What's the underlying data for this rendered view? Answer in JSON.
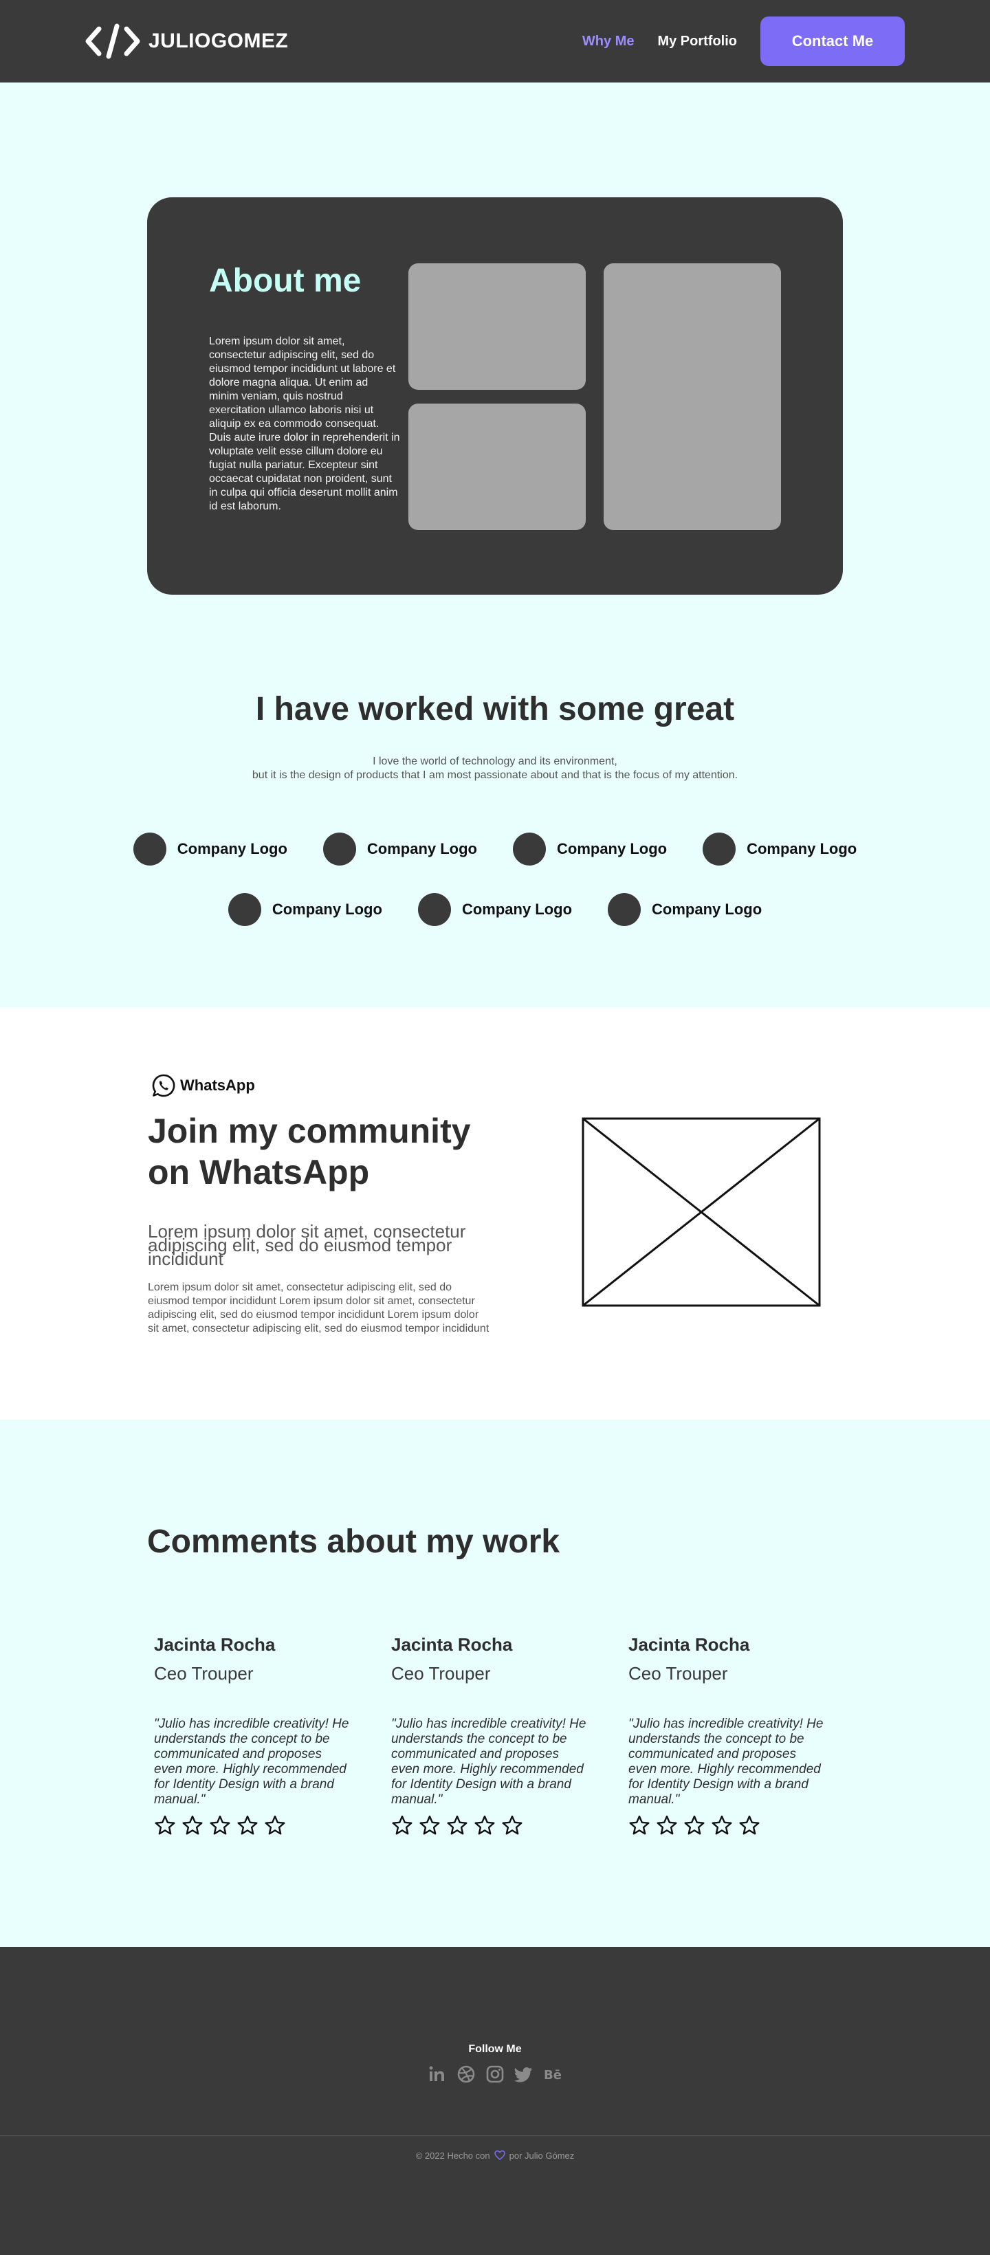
{
  "header": {
    "brand": "JULIOGOMEZ",
    "nav": [
      {
        "label": "Why Me",
        "active": true
      },
      {
        "label": "My Portfolio",
        "active": false
      }
    ],
    "contact_label": "Contact Me"
  },
  "about": {
    "title": "About me",
    "text": "Lorem ipsum dolor sit amet, consectetur adipiscing elit, sed do eiusmod tempor incididunt ut labore et dolore magna aliqua. Ut enim ad minim veniam, quis nostrud exercitation ullamco laboris nisi ut aliquip ex ea commodo consequat. Duis aute irure dolor in reprehenderit in voluptate velit esse cillum dolore eu fugiat nulla pariatur. Excepteur sint occaecat cupidatat non proident, sunt in culpa qui officia deserunt mollit anim id est laborum."
  },
  "worked": {
    "title": "I have worked with some great",
    "subtitle_line1": "I love the world of technology and its environment,",
    "subtitle_line2": "but it is the design of products that I am most passionate about and that is the focus of my attention.",
    "companies": [
      "Company Logo",
      "Company Logo",
      "Company Logo",
      "Company Logo",
      "Company Logo",
      "Company Logo",
      "Company Logo"
    ]
  },
  "whatsapp": {
    "brand": "WhatsApp",
    "title": "Join my community on WhatsApp",
    "lead": "Lorem ipsum dolor sit amet, consectetur adipiscing elit, sed do eiusmod tempor incididunt",
    "body": "Lorem ipsum dolor sit amet, consectetur adipiscing elit, sed do eiusmod tempor incididunt Lorem ipsum dolor sit amet, consectetur adipiscing elit, sed do eiusmod tempor incididunt Lorem ipsum dolor sit amet, consectetur adipiscing elit, sed do eiusmod tempor incididunt"
  },
  "comments": {
    "title": "Comments about my work",
    "reviews": [
      {
        "name": "Jacinta Rocha",
        "role": "Ceo Trouper",
        "quote": "\"Julio has incredible creativity! He understands the concept to be communicated and proposes even more. Highly recommended for Identity Design with a brand manual.\"",
        "stars": 5
      },
      {
        "name": "Jacinta Rocha",
        "role": "Ceo Trouper",
        "quote": "\"Julio has incredible creativity! He understands the concept to be communicated and proposes even more. Highly recommended for Identity Design with a brand manual.\"",
        "stars": 5
      },
      {
        "name": "Jacinta Rocha",
        "role": "Ceo Trouper",
        "quote": "\"Julio has incredible creativity! He understands the concept to be communicated and proposes even more. Highly recommended for Identity Design with a brand manual.\"",
        "stars": 5
      }
    ]
  },
  "footer": {
    "follow_label": "Follow Me",
    "socials": [
      "linkedin-icon",
      "dribbble-icon",
      "instagram-icon",
      "twitter-icon",
      "behance-icon"
    ],
    "copyright_left": "© 2022 Hecho con",
    "copyright_right": "por Julio Gómez"
  },
  "colors": {
    "accent": "#7c6cf6",
    "dark": "#3b3a3a",
    "background": "#e8fffd",
    "about_title": "#c4fff6"
  }
}
